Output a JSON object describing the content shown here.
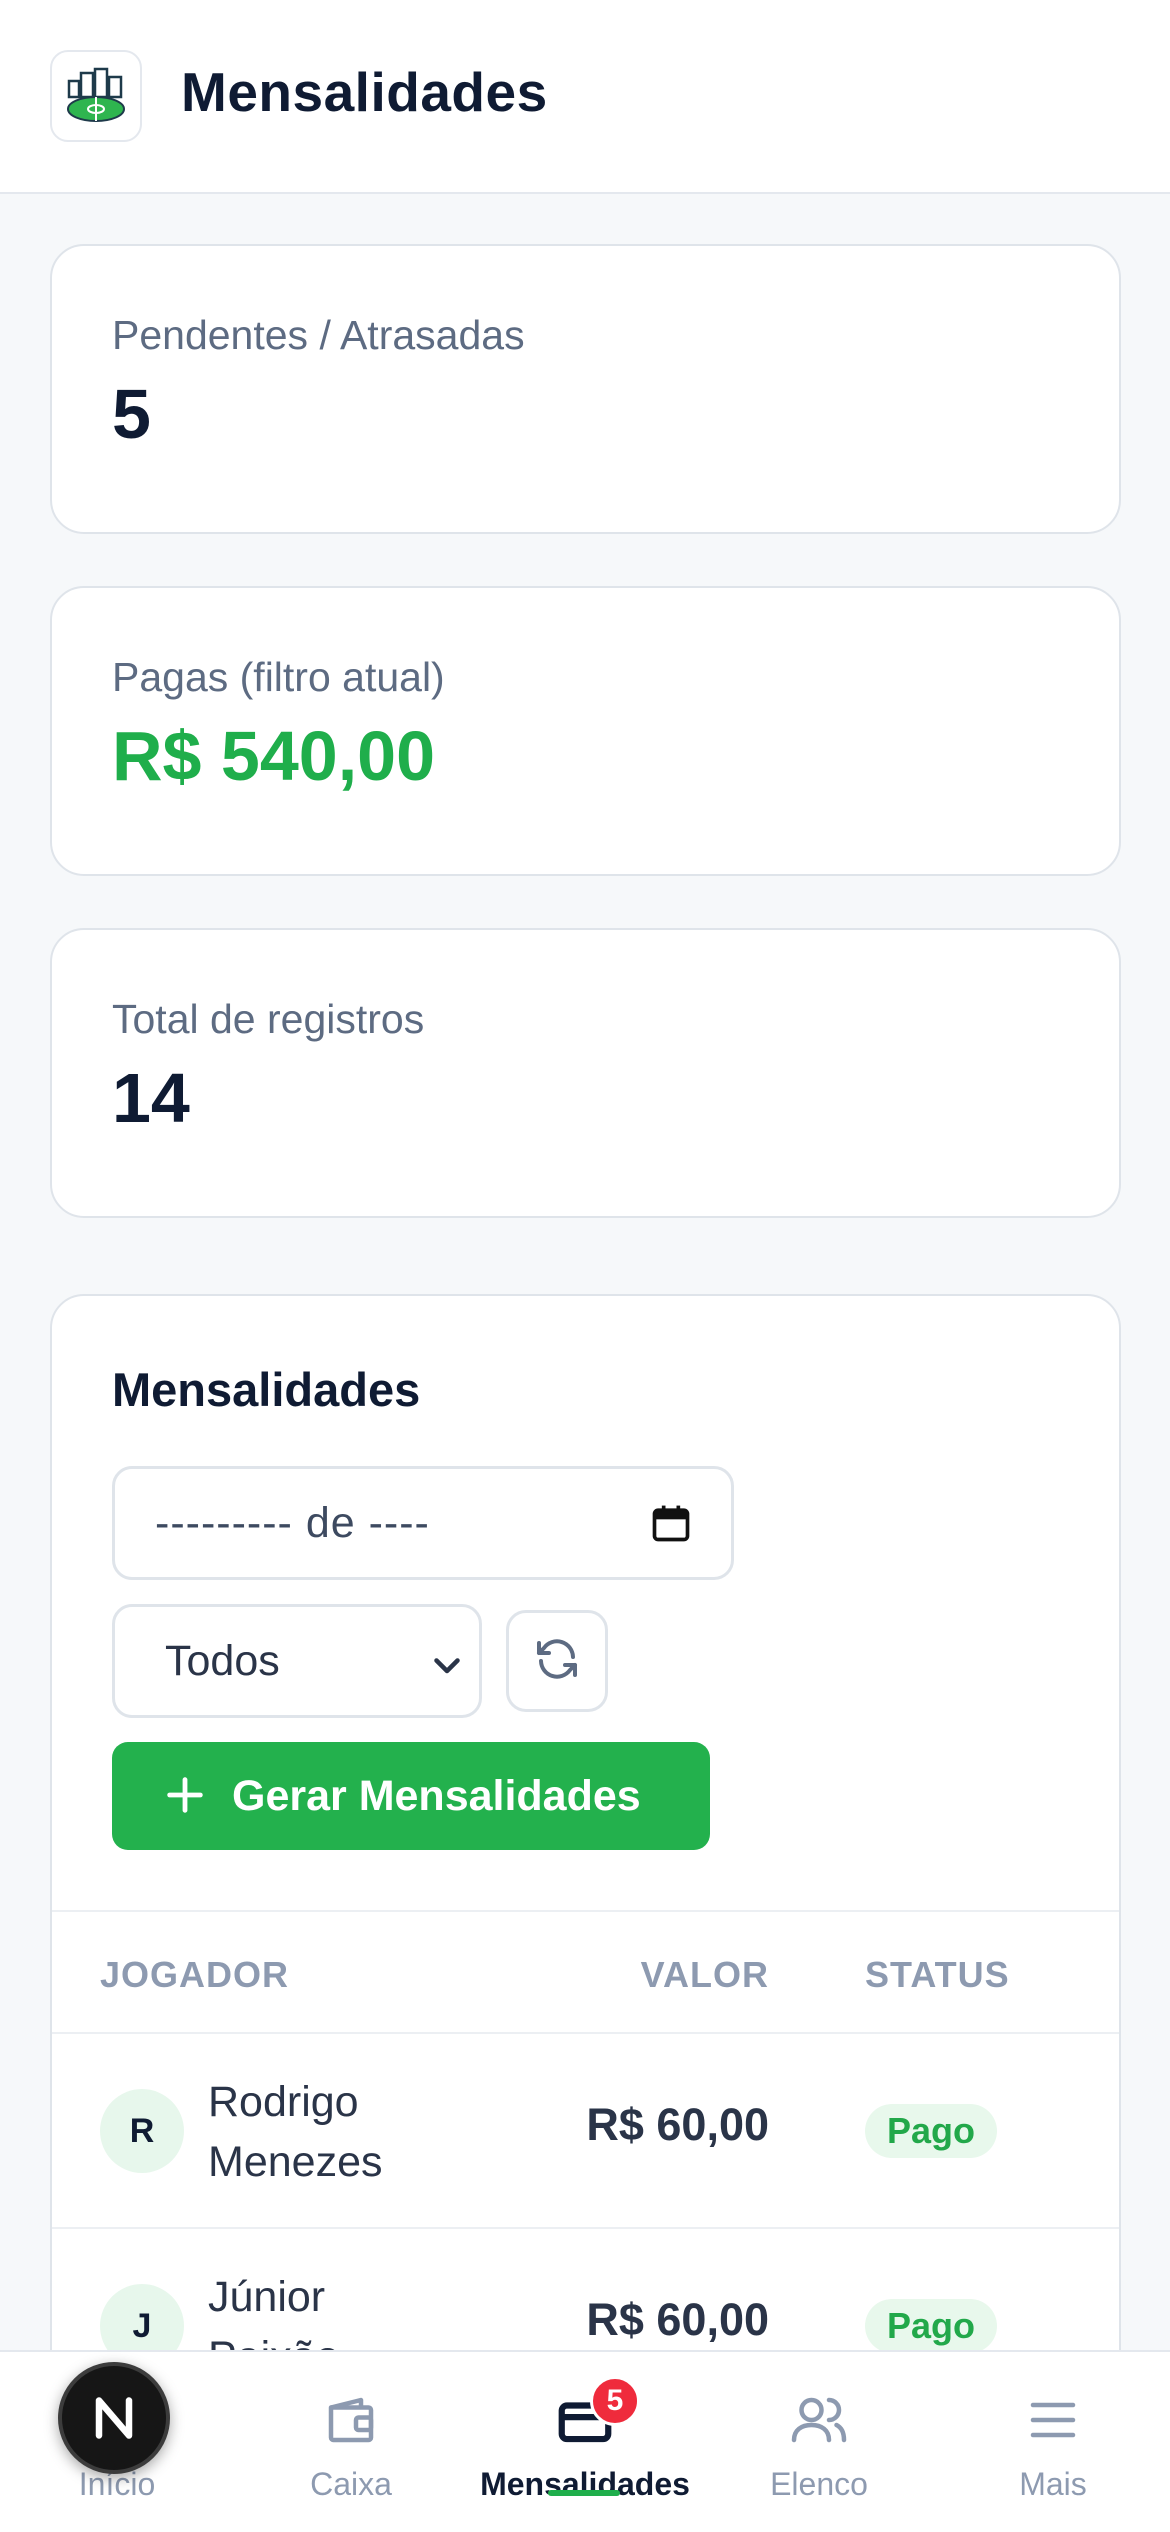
{
  "header": {
    "title": "Mensalidades",
    "logo_icon": "stadium-logo"
  },
  "stats": [
    {
      "label": "Pendentes / Atrasadas",
      "value": "5"
    },
    {
      "label": "Pagas (filtro atual)",
      "value": "R$ 540,00",
      "color": "#1fae4b"
    },
    {
      "label": "Total de registros",
      "value": "14"
    }
  ],
  "panel": {
    "title": "Mensalidades",
    "month_input": {
      "display": "--------- de ----",
      "icon": "calendar-icon"
    },
    "status_select": {
      "selected": "Todos"
    },
    "refresh_icon": "refresh-icon",
    "generate_button": "Gerar Mensalidades",
    "table": {
      "headers": {
        "player": "JOGADOR",
        "value": "VALOR",
        "status": "STATUS"
      },
      "rows": [
        {
          "initial": "R",
          "name": "Rodrigo Menezes",
          "value": "R$ 60,00",
          "status": "Pago"
        },
        {
          "initial": "J",
          "name": "Júnior Paixão",
          "value": "R$ 60,00",
          "status": "Pago"
        }
      ]
    }
  },
  "bottom_nav": {
    "items": [
      {
        "label": "Início",
        "icon": "home-icon"
      },
      {
        "label": "Caixa",
        "icon": "wallet-icon"
      },
      {
        "label": "Mensalidades",
        "icon": "card-icon",
        "badge": "5"
      },
      {
        "label": "Elenco",
        "icon": "users-icon"
      },
      {
        "label": "Mais",
        "icon": "menu-icon"
      }
    ],
    "active": "Mensalidades"
  },
  "fab_letter": "N",
  "colors": {
    "accent": "#1fae4b",
    "badge": "#ef2b3c",
    "text": "#0f1b33"
  }
}
